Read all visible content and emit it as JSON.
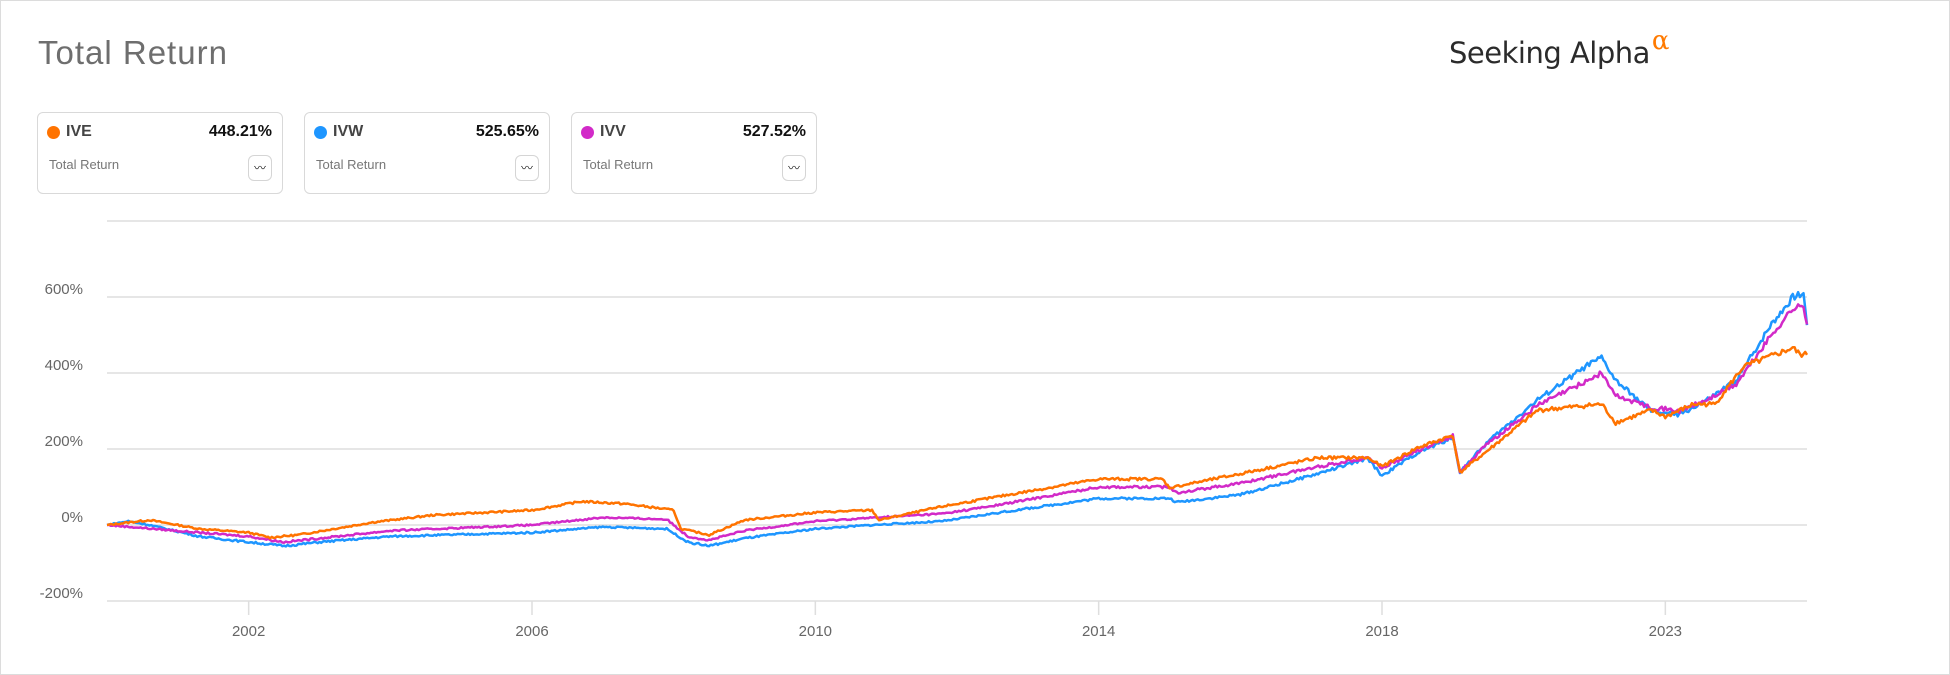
{
  "header": {
    "title": "Total Return",
    "logo_text": "Seeking Alpha",
    "logo_symbol": "α"
  },
  "cards": [
    {
      "ticker": "IVE",
      "value": "448.21%",
      "label": "Total Return",
      "color": "#ff7300",
      "icon": "chart-toggle-icon"
    },
    {
      "ticker": "IVW",
      "value": "525.65%",
      "label": "Total Return",
      "color": "#1e96ff",
      "icon": "chart-toggle-icon"
    },
    {
      "ticker": "IVV",
      "value": "527.52%",
      "label": "Total Return",
      "color": "#d22ac8",
      "icon": "chart-toggle-icon"
    }
  ],
  "chart_data": {
    "type": "line",
    "title": "Total Return",
    "xlabel": "",
    "ylabel": "",
    "xlim": [
      2000,
      2024
    ],
    "ylim": [
      -200,
      800
    ],
    "grid": true,
    "y_ticks": [
      {
        "value": 600,
        "label": "600%"
      },
      {
        "value": 400,
        "label": "400%"
      },
      {
        "value": 200,
        "label": "200%"
      },
      {
        "value": 0,
        "label": "0%"
      },
      {
        "value": -200,
        "label": "-200%"
      }
    ],
    "x_ticks": [
      {
        "value": 2002,
        "label": "2002"
      },
      {
        "value": 2006,
        "label": "2006"
      },
      {
        "value": 2010,
        "label": "2010"
      },
      {
        "value": 2014,
        "label": "2014"
      },
      {
        "value": 2018,
        "label": "2018"
      },
      {
        "value": 2022,
        "label": "2023"
      }
    ],
    "series": [
      {
        "name": "IVE",
        "color": "#ff7300",
        "x": [
          2000,
          2000.6,
          2001.3,
          2002,
          2002.3,
          2002.7,
          2003.75,
          2004.6,
          2006,
          2006.7,
          2007.3,
          2008,
          2008.1,
          2008.5,
          2009,
          2010,
          2010.8,
          2010.9,
          2011.8,
          2012.5,
          2014,
          2014.9,
          2015,
          2015.9,
          2017.1,
          2017.8,
          2018,
          2018.5,
          2019,
          2019.1,
          2019.5,
          2020.2,
          2021.1,
          2021.3,
          2021.8,
          2022,
          2022.4,
          2022.7,
          2023.1,
          2023.8,
          2023.9,
          2024
        ],
        "y": [
          0,
          13,
          -10,
          -20,
          -33,
          -26,
          7,
          26,
          39,
          62,
          56,
          39,
          -10,
          -26,
          13,
          33,
          39,
          13,
          49,
          72,
          121,
          121,
          98,
          131,
          177,
          177,
          154,
          203,
          236,
          138,
          197,
          302,
          318,
          269,
          302,
          285,
          318,
          318,
          416,
          466,
          449,
          448
        ]
      },
      {
        "name": "IVW",
        "color": "#1e96ff",
        "x": [
          2000,
          2000.3,
          2000.6,
          2001.3,
          2002,
          2002.5,
          2003,
          2004,
          2006,
          2007,
          2007.9,
          2008.2,
          2008.5,
          2009,
          2010,
          2010.8,
          2011.8,
          2012.5,
          2014,
          2015,
          2015.1,
          2016,
          2017,
          2017.8,
          2018,
          2018.5,
          2019,
          2019.1,
          2019.5,
          2020.2,
          2020.9,
          2021.1,
          2021.3,
          2021.8,
          2022.2,
          2022.6,
          2023,
          2023.5,
          2023.8,
          2023.95,
          2024
        ],
        "y": [
          0,
          10,
          0,
          -30,
          -45,
          -55,
          -45,
          -30,
          -20,
          -5,
          -10,
          -45,
          -55,
          -35,
          -10,
          0,
          10,
          30,
          70,
          70,
          60,
          80,
          130,
          175,
          130,
          190,
          230,
          140,
          220,
          330,
          420,
          440,
          380,
          300,
          290,
          330,
          380,
          530,
          600,
          610,
          526
        ]
      },
      {
        "name": "IVV",
        "color": "#d22ac8",
        "x": [
          2000,
          2001.3,
          2002,
          2002.5,
          2003,
          2004,
          2006,
          2007,
          2007.9,
          2008.2,
          2008.5,
          2009,
          2010,
          2011.8,
          2012.5,
          2014,
          2015,
          2015.1,
          2016,
          2017,
          2017.8,
          2018,
          2018.5,
          2019,
          2019.1,
          2019.5,
          2020.2,
          2020.9,
          2021.1,
          2021.3,
          2021.8,
          2022.2,
          2022.6,
          2023,
          2023.5,
          2023.8,
          2023.95,
          2024
        ],
        "y": [
          0,
          -20,
          -30,
          -45,
          -35,
          -15,
          0,
          20,
          15,
          -30,
          -40,
          -15,
          10,
          30,
          50,
          100,
          100,
          85,
          110,
          150,
          178,
          150,
          195,
          235,
          140,
          215,
          315,
          380,
          400,
          340,
          310,
          300,
          330,
          370,
          500,
          570,
          575,
          528
        ]
      }
    ]
  }
}
